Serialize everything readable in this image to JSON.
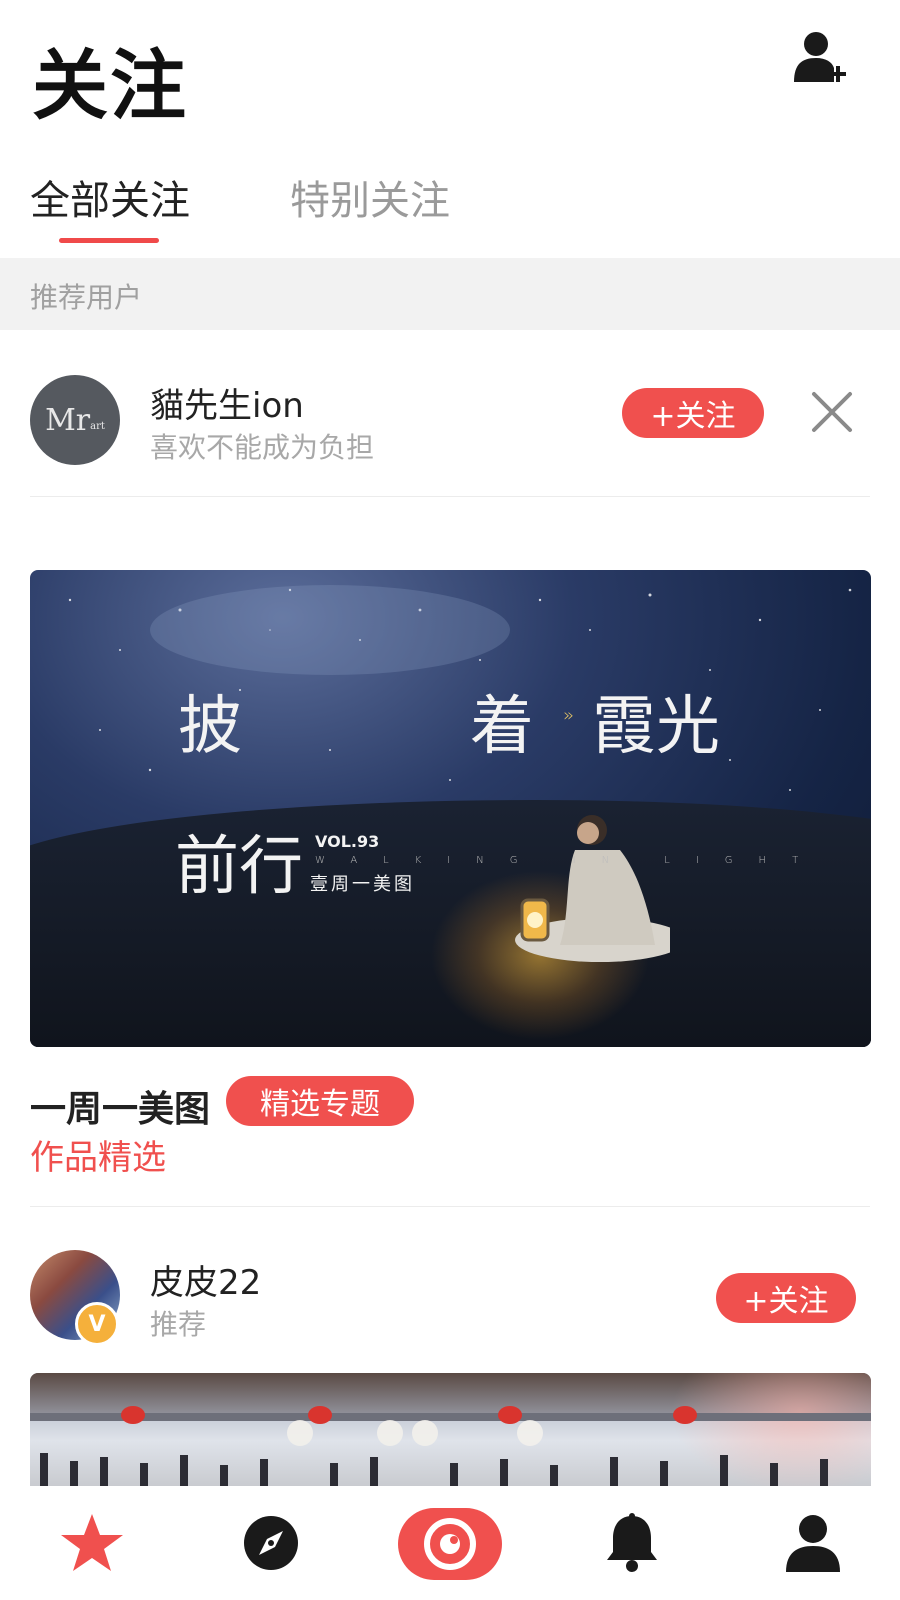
{
  "header": {
    "title": "关注"
  },
  "tabs": [
    {
      "label": "全部关注",
      "active": true
    },
    {
      "label": "特别关注",
      "active": false
    }
  ],
  "section": {
    "label": "推荐用户"
  },
  "recommended_user": {
    "name": "貓先生ion",
    "subtitle": "喜欢不能成为负担",
    "avatar_text": "Mr",
    "avatar_small": "art",
    "follow_label": "+关注"
  },
  "banner": {
    "line1_a": "披",
    "line1_b": "着",
    "line1_chev": "»",
    "line1_c": "霞光",
    "line2": "前行",
    "vol": "VOL.93",
    "walking": "WALKING IN LIGHT",
    "brand": "壹周一美图"
  },
  "post": {
    "title": "一周一美图",
    "tag": "精选专题",
    "subtitle": "作品精选"
  },
  "second_user": {
    "name": "皮皮22",
    "subtitle": "推荐",
    "badge": "V",
    "follow_label": "+关注"
  },
  "bottom_nav": [
    {
      "icon": "star-icon",
      "active": true
    },
    {
      "icon": "compass-icon",
      "active": false
    },
    {
      "icon": "camera-icon",
      "active": false
    },
    {
      "icon": "bell-icon",
      "active": false
    },
    {
      "icon": "profile-icon",
      "active": false
    }
  ],
  "colors": {
    "accent": "#f0504e",
    "badge": "#f5b03b",
    "text_muted": "#a8a8a8"
  }
}
